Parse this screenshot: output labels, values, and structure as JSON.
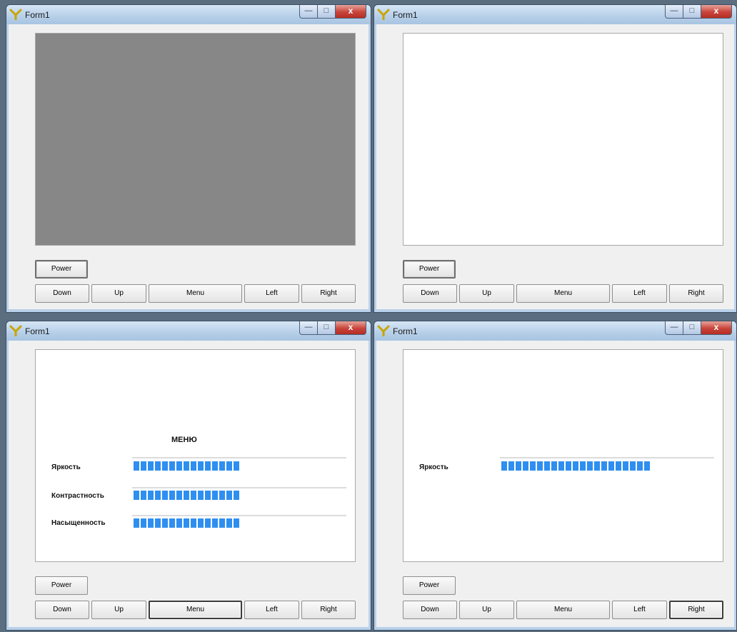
{
  "windows": [
    {
      "title": "Form1",
      "screen": "off"
    },
    {
      "title": "Form1",
      "screen": "on"
    },
    {
      "title": "Form1",
      "screen": "menu"
    },
    {
      "title": "Form1",
      "screen": "brightness"
    }
  ],
  "controls": {
    "minimize": "—",
    "maximize": "□",
    "close": "x"
  },
  "buttons": {
    "power": "Power",
    "down": "Down",
    "up": "Up",
    "menu": "Menu",
    "left": "Left",
    "right": "Right"
  },
  "menu_screen": {
    "title": "МЕНЮ",
    "items": [
      {
        "label": "Яркость",
        "level": 0.5
      },
      {
        "label": "Контрастность",
        "level": 0.5
      },
      {
        "label": "Насыщенность",
        "level": 0.5
      }
    ]
  },
  "brightness_screen": {
    "label": "Яркость",
    "level": 0.7
  },
  "colors": {
    "screen_off": "#878787",
    "screen_on": "#ffffff",
    "bar": "#2f8ff0",
    "close_button": "#c8443a"
  },
  "icons": [
    "app-icon",
    "minimize-icon",
    "maximize-icon",
    "close-icon"
  ]
}
